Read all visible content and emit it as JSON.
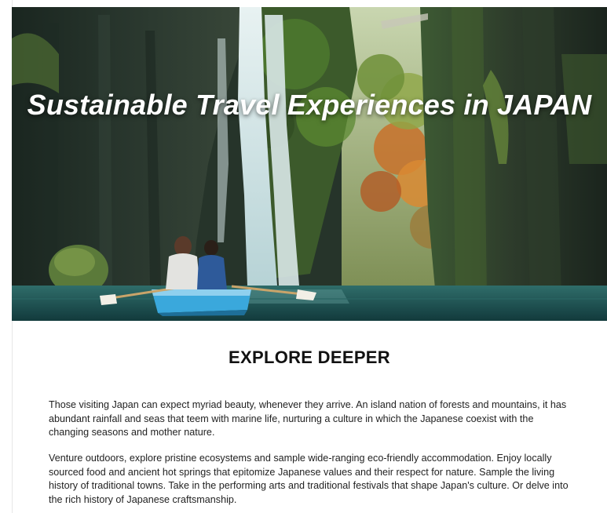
{
  "hero": {
    "title": "Sustainable Travel Experiences in JAPAN",
    "image_description_icon": "waterfall-gorge-boat-photo"
  },
  "section": {
    "heading": "EXPLORE DEEPER"
  },
  "paragraphs": [
    "Those visiting Japan can expect myriad beauty, whenever they arrive. An island nation of forests and mountains, it has abundant rainfall and seas that teem with marine life, nurturing a culture in which the Japanese coexist with the changing seasons and mother nature.",
    "Venture outdoors, explore pristine ecosystems and sample wide-ranging eco-friendly accommodation. Enjoy locally sourced food and ancient hot springs that epitomize Japanese values and their respect for nature. Sample the living history of traditional towns. Take in the performing arts and traditional festivals that shape Japan's culture. Or delve into the rich history of Japanese craftsmanship."
  ],
  "colors": {
    "title_text": "#ffffff",
    "heading_text": "#111111",
    "body_text": "#222222",
    "boat": "#3aa8dc",
    "water": "#1f5a5c",
    "cliff": "#24322a",
    "moss": "#4f7a2e",
    "autumn": "#d2802e"
  }
}
